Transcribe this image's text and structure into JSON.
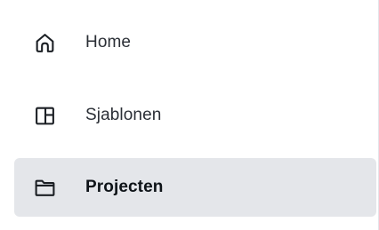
{
  "sidebar": {
    "items": [
      {
        "label": "Home",
        "icon": "home-icon",
        "active": false
      },
      {
        "label": "Sjablonen",
        "icon": "templates-icon",
        "active": false
      },
      {
        "label": "Projecten",
        "icon": "folder-icon",
        "active": true
      }
    ]
  },
  "colors": {
    "active_background": "#e4e6ea",
    "text": "#0e1318"
  }
}
